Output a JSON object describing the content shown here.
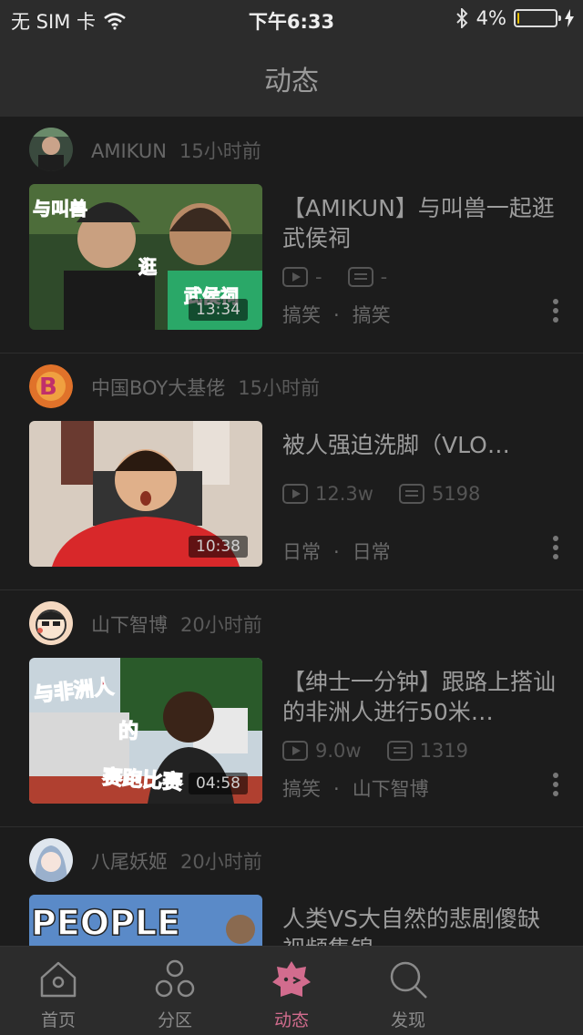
{
  "status_bar": {
    "carrier": "无 SIM 卡",
    "time": "下午6:33",
    "battery": "4%",
    "battery_level": 0.04,
    "icons": [
      "wifi-icon",
      "bluetooth-icon",
      "battery-icon",
      "charging-icon"
    ]
  },
  "nav": {
    "title": "动态"
  },
  "feed": {
    "items": [
      {
        "author": "AMIKUN",
        "time_ago": "15小时前",
        "title": "【AMIKUN】与叫兽一起逛武侯祠",
        "duration": "13:34",
        "plays": "-",
        "danmaku": "-",
        "tag1": "搞笑",
        "tag2": "搞笑"
      },
      {
        "author": "中国BOY大基佬",
        "time_ago": "15小时前",
        "title": "被人强迫洗脚（VLO…",
        "duration": "10:38",
        "plays": "12.3w",
        "danmaku": "5198",
        "tag1": "日常",
        "tag2": "日常"
      },
      {
        "author": "山下智博",
        "time_ago": "20小时前",
        "title": "【绅士一分钟】跟路上搭讪的非洲人进行50米…",
        "duration": "04:58",
        "plays": "9.0w",
        "danmaku": "1319",
        "tag1": "搞笑",
        "tag2": "山下智博"
      },
      {
        "author": "八尾妖姬",
        "time_ago": "20小时前",
        "title": "人类VS大自然的悲剧傻缺视频集锦",
        "thumb_text": "PEOPLE"
      }
    ]
  },
  "tab_bar": {
    "tabs": [
      {
        "label": "首页",
        "icon": "home-icon"
      },
      {
        "label": "分区",
        "icon": "circles-icon"
      },
      {
        "label": "动态",
        "icon": "dynamic-icon",
        "active": true
      },
      {
        "label": "发现",
        "icon": "search-icon"
      }
    ]
  },
  "colors": {
    "accent": "#d26c8e",
    "background": "#1c1c1c",
    "bar": "#2c2c2c"
  }
}
